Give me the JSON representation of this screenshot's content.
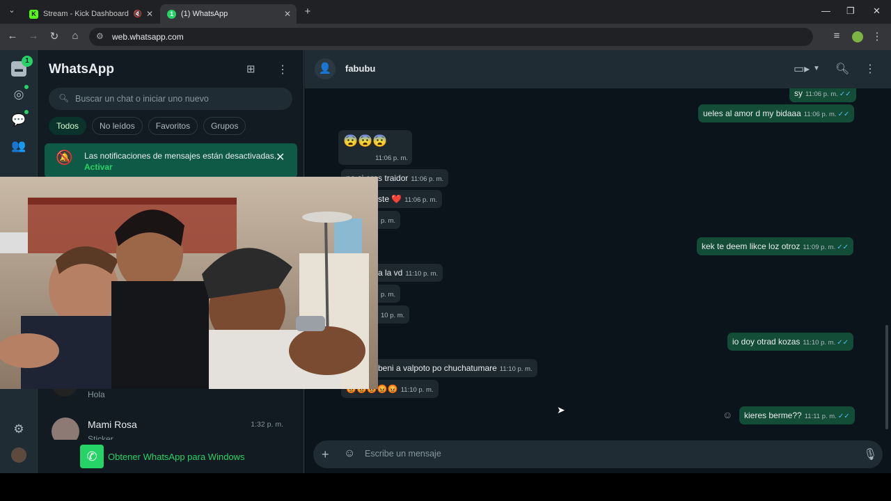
{
  "browser": {
    "tabs": [
      {
        "label": "Stream - Kick Dashboard"
      },
      {
        "label": "(1) WhatsApp"
      }
    ],
    "url": "web.whatsapp.com"
  },
  "rail": {
    "unread_badge": "1"
  },
  "sidebar": {
    "title": "WhatsApp",
    "search_placeholder": "Buscar un chat o iniciar uno nuevo",
    "filters": [
      "Todos",
      "No leídos",
      "Favoritos",
      "Grupos"
    ],
    "notification": {
      "text": "Las notificaciones de mensajes están desactivadas.",
      "action": "Activar"
    },
    "chats": [
      {
        "name": "",
        "preview": "Hola",
        "time": ""
      },
      {
        "name": "Mami Rosa",
        "preview": "Sticker",
        "time": "1:32 p. m."
      }
    ],
    "get_app": "Obtener WhatsApp para Windows"
  },
  "conversation": {
    "contact": "fabubu",
    "messages_out": [
      {
        "text": "sy",
        "time": "11:06 p. m."
      },
      {
        "text": "ueles al amor d my bidaaa",
        "time": "11:06 p. m."
      },
      {
        "text": "kek te deem likce loz otroz",
        "time": "11:09 p. m."
      },
      {
        "text": "io doy otrad kozas",
        "time": "11:10 p. m."
      },
      {
        "text": "kieres berme??",
        "time": "11:11 p. m."
      }
    ],
    "messages_in": [
      {
        "text": "😨😨😨",
        "time": "11:06 p. m."
      },
      {
        "text": "no si eres traidor",
        "time": "11:06 p. m."
      },
      {
        "text": "ste ❤️",
        "time": "11:06 p. m."
      },
      {
        "text": "",
        "time": "p. m."
      },
      {
        "text": "a la vd",
        "time": "11:10 p. m."
      },
      {
        "text": "",
        "time": "p. m."
      },
      {
        "text": "",
        "time": "10 p. m."
      },
      {
        "text": "beni a valpoto po chuchatumare",
        "time": "11:10 p. m."
      },
      {
        "text": "😡😡😡😡😡",
        "time": "11:10 p. m."
      }
    ],
    "composer_placeholder": "Escribe un mensaje"
  },
  "colors": {
    "accent": "#25d366",
    "outgoing_bubble": "#144d37",
    "incoming_bubble": "#1d282f",
    "panel": "#111b21"
  }
}
